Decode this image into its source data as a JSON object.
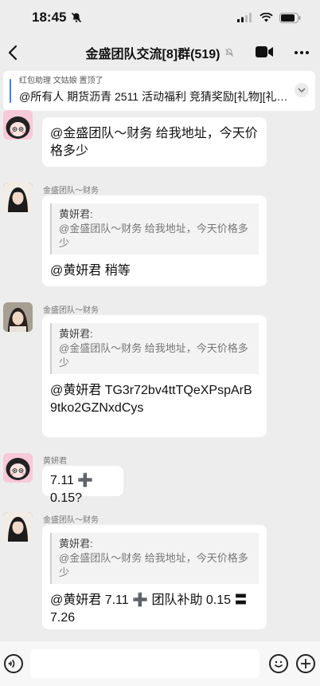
{
  "status": {
    "time": "18:45"
  },
  "nav": {
    "title": "金盛团队交流[8]群(519)"
  },
  "pinned": {
    "meta": "红包助理 文姑娘 置顶了",
    "text": "@所有人 期货沥青 2511 活动福利 竞猜奖励[礼物][礼…"
  },
  "messages": [
    {
      "type": "text",
      "sender": "",
      "text": "@金盛团队～财务 给我地址，今天价格多少"
    },
    {
      "type": "reply",
      "sender": "金盛团队～财务",
      "quote_name": "黄妍君:",
      "quote_text": "@金盛团队～财务 给我地址，今天价格多少",
      "text": "@黄妍君 稍等"
    },
    {
      "type": "reply",
      "sender": "金盛团队～财务",
      "quote_name": "黄妍君:",
      "quote_text": "@金盛团队～财务 给我地址，今天价格多少",
      "text": "@黄妍君 TG3r72bv4ttTQeXPspArB9tko2GZNxdCys"
    },
    {
      "type": "text",
      "sender": "黄妍君",
      "text": "7.11 ➕ 0.15?"
    },
    {
      "type": "reply",
      "sender": "金盛团队～财务",
      "quote_name": "黄妍君:",
      "quote_text": "@金盛团队～财务 给我地址，今天价格多少",
      "text": "@黄妍君 7.11 ➕ 团队补助 0.15 〓 7.26"
    }
  ]
}
